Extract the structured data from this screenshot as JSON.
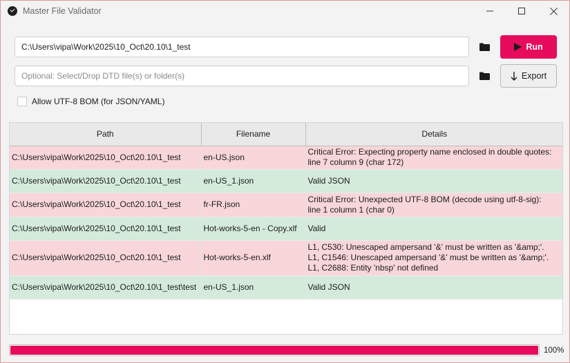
{
  "window": {
    "title": "Master File Validator",
    "controls": [
      "minimize-icon",
      "maximize-icon",
      "close-icon"
    ]
  },
  "inputs": {
    "source_value": "C:\\Users\\vipa\\Work\\2025\\10_Oct\\20.10\\1_test",
    "dtd_placeholder": "Optional: Select/Drop DTD file(s) or folder(s)",
    "dtd_value": ""
  },
  "buttons": {
    "run_label": "Run",
    "export_label": "Export"
  },
  "options": {
    "bom_label": "Allow UTF-8 BOM (for JSON/YAML)",
    "bom_checked": false
  },
  "table": {
    "headers": [
      "Path",
      "Filename",
      "Details"
    ],
    "rows": [
      {
        "status": "error",
        "path": "C:\\Users\\vipa\\Work\\2025\\10_Oct\\20.10\\1_test",
        "filename": "en-US.json",
        "details": [
          "Critical Error: Expecting property name enclosed in double quotes:",
          "line 7 column 9 (char 172)"
        ]
      },
      {
        "status": "valid",
        "path": "C:\\Users\\vipa\\Work\\2025\\10_Oct\\20.10\\1_test",
        "filename": "en-US_1.json",
        "details": [
          "Valid JSON"
        ]
      },
      {
        "status": "error",
        "path": "C:\\Users\\vipa\\Work\\2025\\10_Oct\\20.10\\1_test",
        "filename": "fr-FR.json",
        "details": [
          "Critical Error: Unexpected UTF-8 BOM (decode using utf-8-sig):",
          "line 1 column 1 (char 0)"
        ]
      },
      {
        "status": "valid",
        "path": "C:\\Users\\vipa\\Work\\2025\\10_Oct\\20.10\\1_test",
        "filename": "Hot-works-5-en - Copy.xlf",
        "details": [
          "Valid"
        ]
      },
      {
        "status": "error",
        "path": "C:\\Users\\vipa\\Work\\2025\\10_Oct\\20.10\\1_test",
        "filename": "Hot-works-5-en.xlf",
        "details": [
          "L1, C530: Unescaped ampersand '&' must be written as '&amp;'.",
          "L1, C1546: Unescaped ampersand '&' must be written as '&amp;'.",
          "L1, C2688: Entity 'nbsp' not defined"
        ]
      },
      {
        "status": "valid",
        "path": "C:\\Users\\vipa\\Work\\2025\\10_Oct\\20.10\\1_test\\test",
        "filename": "en-US_1.json",
        "details": [
          "Valid JSON"
        ]
      }
    ]
  },
  "progress": {
    "value": 100,
    "label": "100%"
  },
  "colors": {
    "accent": "#e60b5c",
    "error_row": "#f8d6da",
    "valid_row": "#d4ebdc"
  }
}
